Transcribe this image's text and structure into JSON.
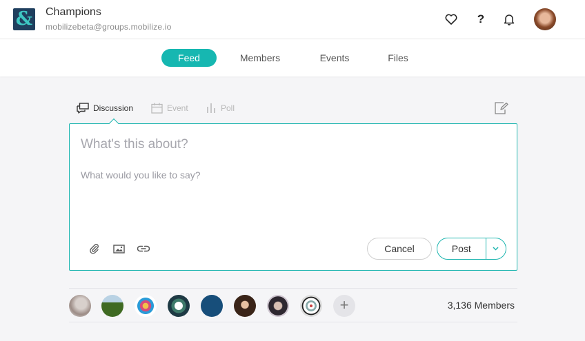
{
  "header": {
    "group_name": "Champions",
    "group_email": "mobilizebeta@groups.mobilize.io",
    "help_label": "?",
    "icons": [
      "heart-icon",
      "help-icon",
      "bell-icon"
    ]
  },
  "nav": {
    "tabs": [
      {
        "label": "Feed",
        "active": true
      },
      {
        "label": "Members",
        "active": false
      },
      {
        "label": "Events",
        "active": false
      },
      {
        "label": "Files",
        "active": false
      }
    ]
  },
  "composer": {
    "tabs": [
      {
        "label": "Discussion",
        "active": true
      },
      {
        "label": "Event",
        "active": false
      },
      {
        "label": "Poll",
        "active": false
      }
    ],
    "title_placeholder": "What's this about?",
    "body_placeholder": "What would you like to say?",
    "cancel_label": "Cancel",
    "post_label": "Post"
  },
  "members": {
    "count_label": "3,136 Members",
    "add_label": "+"
  },
  "colors": {
    "accent": "#16b7b1",
    "logo_bg": "#1f3f5e"
  }
}
